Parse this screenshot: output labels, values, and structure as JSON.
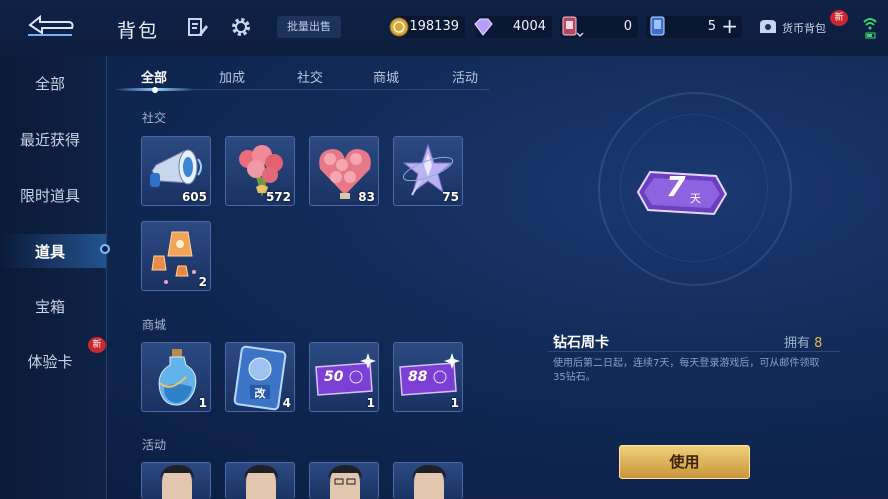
{
  "header": {
    "title": "背包",
    "bulk_sell": "批量出售",
    "currencies": [
      {
        "icon": "gold-coin-icon",
        "value": "198139"
      },
      {
        "icon": "diamond-icon",
        "value": "4004"
      },
      {
        "icon": "ticket-card-icon",
        "value": "0"
      },
      {
        "icon": "blue-card-icon",
        "value": "5"
      }
    ],
    "wallet_label": "货币背包",
    "new_badge": "新"
  },
  "sidebar": {
    "items": [
      {
        "label": "全部"
      },
      {
        "label": "最近获得"
      },
      {
        "label": "限时道具"
      },
      {
        "label": "道具"
      },
      {
        "label": "宝箱"
      },
      {
        "label": "体验卡"
      }
    ],
    "active_index": 3,
    "new_badge": "新"
  },
  "tabs": [
    {
      "label": "全部"
    },
    {
      "label": "加成"
    },
    {
      "label": "社交"
    },
    {
      "label": "商城"
    },
    {
      "label": "活动"
    }
  ],
  "sections": {
    "social": {
      "title": "社交",
      "items": [
        {
          "icon": "megaphone-icon",
          "count": "605"
        },
        {
          "icon": "rose-bouquet-icon",
          "count": "572"
        },
        {
          "icon": "rose-heart-icon",
          "count": "83"
        },
        {
          "icon": "star-wand-icon",
          "count": "75"
        },
        {
          "icon": "sky-lantern-icon",
          "count": "2"
        }
      ]
    },
    "shop": {
      "title": "商城",
      "items": [
        {
          "icon": "potion-bottle-icon",
          "count": "1"
        },
        {
          "icon": "rename-card-icon",
          "count": "4",
          "label": "改"
        },
        {
          "icon": "coupon-50-icon",
          "count": "1",
          "label": "50"
        },
        {
          "icon": "coupon-88-icon",
          "count": "1",
          "label": "88"
        }
      ]
    },
    "event": {
      "title": "活动",
      "items": [
        {
          "icon": "player-portrait-icon"
        },
        {
          "icon": "player-portrait-icon"
        },
        {
          "icon": "player-portrait-icon"
        },
        {
          "icon": "player-portrait-icon"
        }
      ]
    }
  },
  "detail": {
    "name": "钻石周卡",
    "owned_label": "拥有",
    "owned_count": "8",
    "card_number": "7",
    "card_unit": "天",
    "description": "使用后第二日起，连续7天，每天登录游戏后，可从邮件领取35钻石。",
    "use_button": "使用"
  },
  "colors": {
    "accent_gold": "#e6b94a",
    "coupon_purple": "#7b3fd6",
    "badge_red": "#c8282e"
  }
}
